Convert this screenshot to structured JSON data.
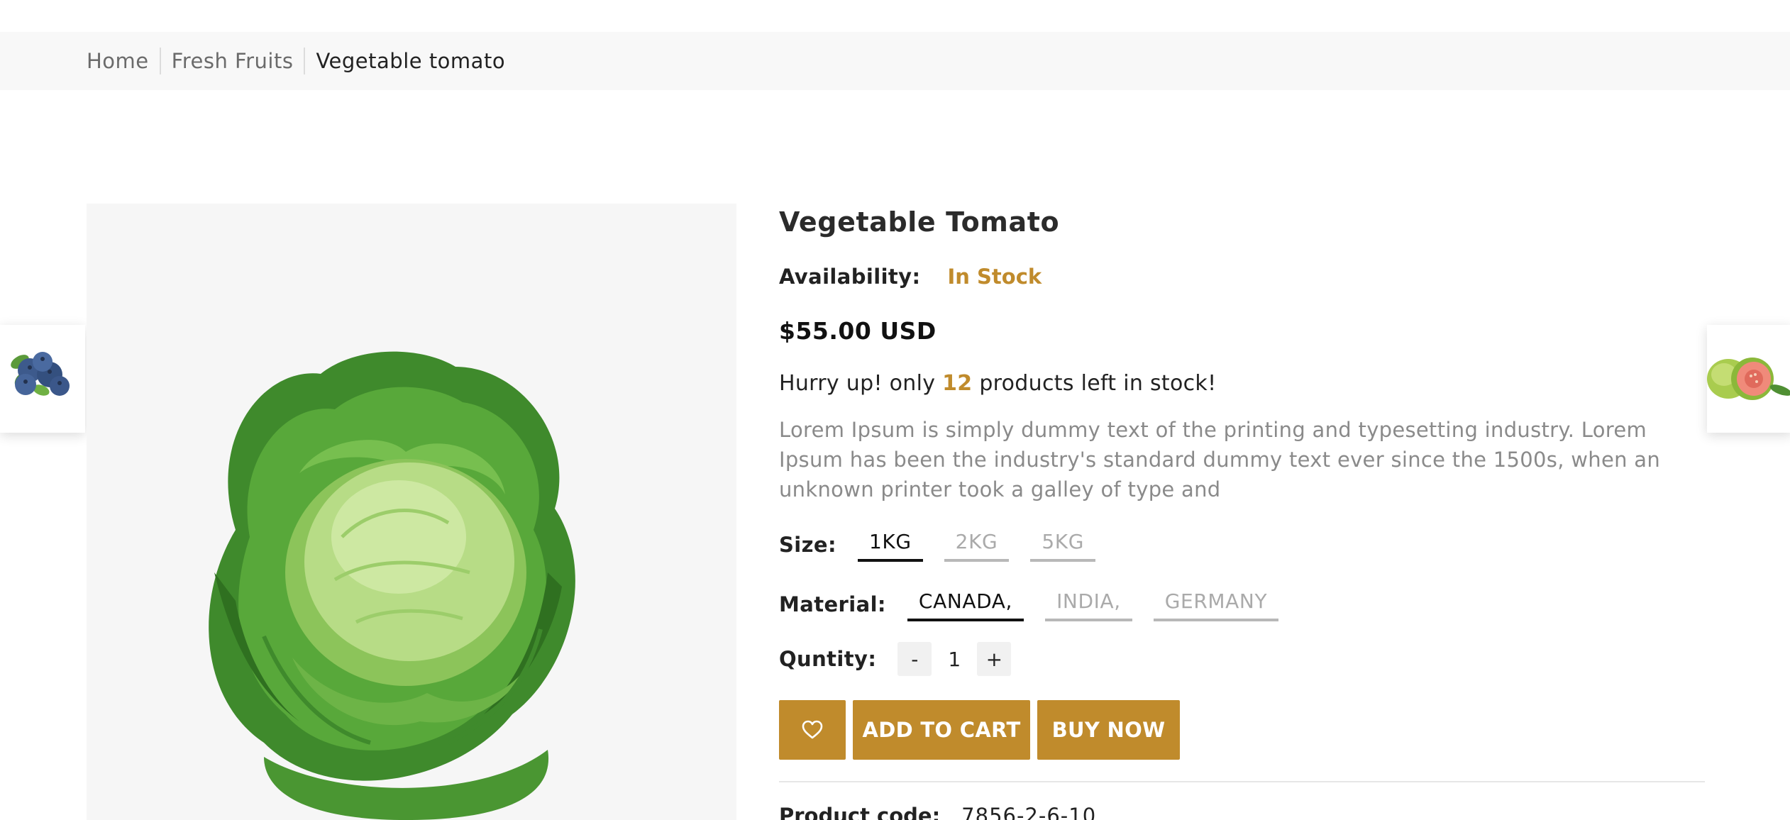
{
  "breadcrumb": [
    "Home",
    "Fresh Fruits",
    "Vegetable tomato"
  ],
  "product": {
    "title": "Vegetable Tomato",
    "availability_label": "Availability:",
    "availability_value": "In Stock",
    "price": "$55.00 USD",
    "stock_prefix": "Hurry up! only",
    "stock_count": "12",
    "stock_suffix": "products left in stock!",
    "description": "Lorem Ipsum is simply dummy text of the printing and typesetting industry. Lorem Ipsum has been the industry's standard dummy text ever since the 1500s, when an unknown printer took a galley of type and",
    "size_label": "Size:",
    "sizes": [
      "1KG",
      "2KG",
      "5KG"
    ],
    "selected_size": "1KG",
    "material_label": "Material:",
    "materials": [
      "CANADA,",
      "INDIA,",
      "GERMANY"
    ],
    "selected_material": "CANADA,",
    "quantity_label": "Quntity:",
    "quantity_minus": "-",
    "quantity": "1",
    "quantity_plus": "+",
    "add_to_cart": "ADD TO CART",
    "buy_now": "BUY NOW",
    "product_code_label": "Product code:",
    "product_code": "7856-2-6-10"
  },
  "icons": {
    "wishlist": "heart-icon"
  },
  "colors": {
    "accent": "#c08b2c",
    "breadcrumb_bg": "#f8f8f8",
    "gallery_bg": "#f6f6f6",
    "muted_text": "#8a8a8a"
  }
}
